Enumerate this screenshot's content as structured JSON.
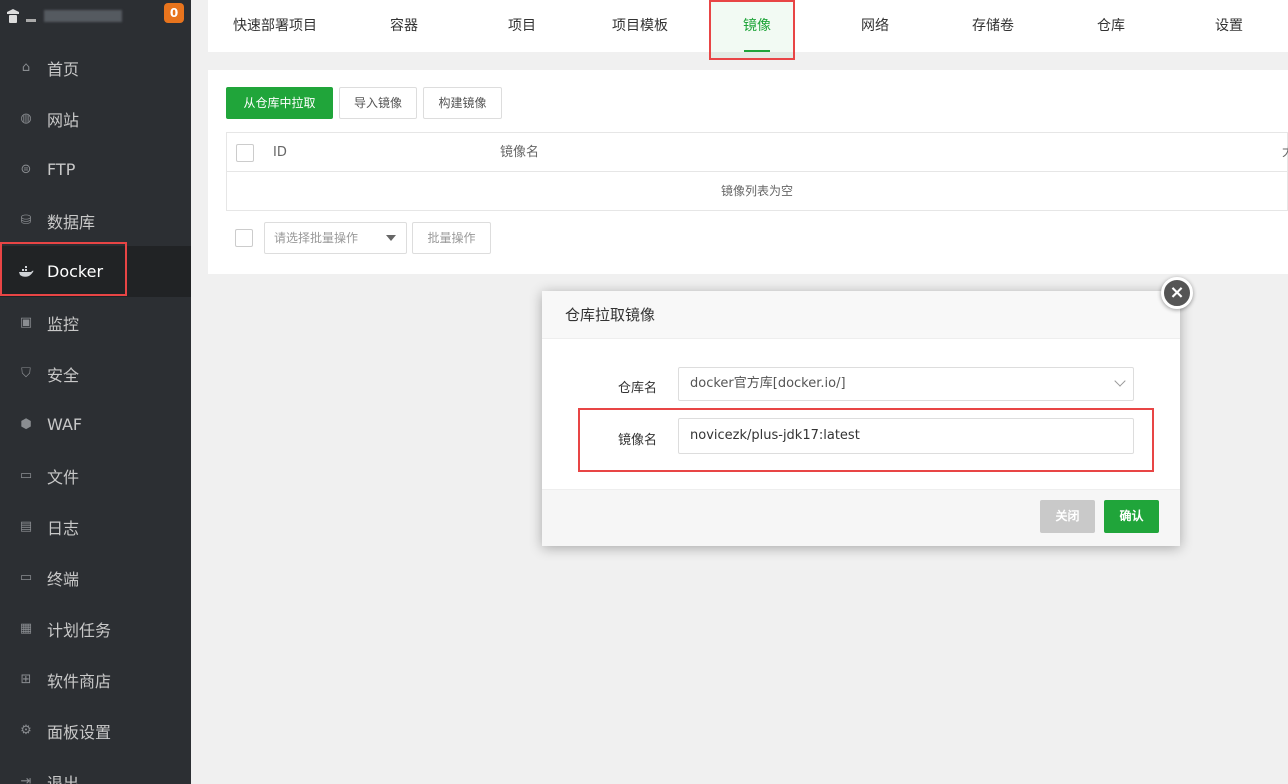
{
  "sidebar": {
    "badge": "0",
    "items": [
      {
        "label": "首页",
        "icon": "home-icon",
        "glyph": "⌂"
      },
      {
        "label": "网站",
        "icon": "globe-icon",
        "glyph": "◍"
      },
      {
        "label": "FTP",
        "icon": "ftp-icon",
        "glyph": "⊜"
      },
      {
        "label": "数据库",
        "icon": "database-icon",
        "glyph": "⛁"
      },
      {
        "label": "Docker",
        "icon": "docker-icon",
        "glyph": "🐳"
      },
      {
        "label": "监控",
        "icon": "monitor-icon",
        "glyph": "▣"
      },
      {
        "label": "安全",
        "icon": "shield-icon",
        "glyph": "⛉"
      },
      {
        "label": "WAF",
        "icon": "waf-shield-icon",
        "glyph": "⬢"
      },
      {
        "label": "文件",
        "icon": "folder-icon",
        "glyph": "▭"
      },
      {
        "label": "日志",
        "icon": "log-icon",
        "glyph": "▤"
      },
      {
        "label": "终端",
        "icon": "terminal-icon",
        "glyph": "▭"
      },
      {
        "label": "计划任务",
        "icon": "calendar-icon",
        "glyph": "▦"
      },
      {
        "label": "软件商店",
        "icon": "apps-icon",
        "glyph": "⊞"
      },
      {
        "label": "面板设置",
        "icon": "gear-icon",
        "glyph": "⚙"
      },
      {
        "label": "退出",
        "icon": "logout-icon",
        "glyph": "⇥"
      }
    ],
    "active_label": "Docker"
  },
  "tabs": [
    {
      "label": "快速部署项目"
    },
    {
      "label": "容器"
    },
    {
      "label": "项目"
    },
    {
      "label": "项目模板"
    },
    {
      "label": "镜像"
    },
    {
      "label": "网络"
    },
    {
      "label": "存储卷"
    },
    {
      "label": "仓库"
    },
    {
      "label": "设置"
    }
  ],
  "active_tab": "镜像",
  "toolbar": {
    "pull_label": "从仓库中拉取",
    "import_label": "导入镜像",
    "build_label": "构建镜像"
  },
  "table": {
    "columns": [
      "ID",
      "镜像名",
      "大"
    ],
    "empty_text": "镜像列表为空"
  },
  "batch": {
    "select_placeholder": "请选择批量操作",
    "button_label": "批量操作"
  },
  "dialog": {
    "title": "仓库拉取镜像",
    "repo_label": "仓库名",
    "repo_value": "docker官方库[docker.io/]",
    "image_label": "镜像名",
    "image_value": "novicezk/plus-jdk17:latest",
    "close_label": "关闭",
    "confirm_label": "确认"
  },
  "colors": {
    "accent": "#20a53a",
    "sidebar_bg": "#2c2f33",
    "highlight_red": "#e84545",
    "badge": "#e8741d"
  }
}
